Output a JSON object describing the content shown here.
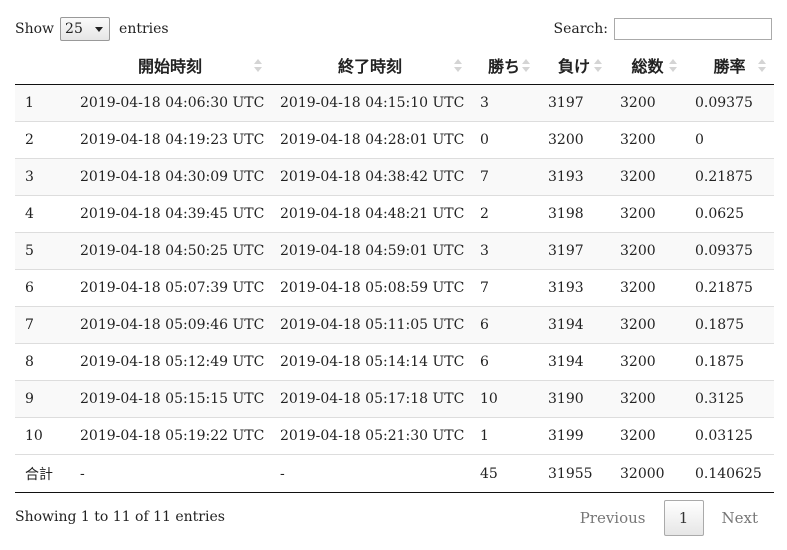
{
  "controls": {
    "show_label": "Show",
    "page_size": "25",
    "entries_label": "entries",
    "search_label": "Search:",
    "search_value": ""
  },
  "table": {
    "headers": [
      "",
      "開始時刻",
      "終了時刻",
      "勝ち",
      "負け",
      "総数",
      "勝率"
    ],
    "rows": [
      [
        "1",
        "2019-04-18 04:06:30 UTC",
        "2019-04-18 04:15:10 UTC",
        "3",
        "3197",
        "3200",
        "0.09375"
      ],
      [
        "2",
        "2019-04-18 04:19:23 UTC",
        "2019-04-18 04:28:01 UTC",
        "0",
        "3200",
        "3200",
        "0"
      ],
      [
        "3",
        "2019-04-18 04:30:09 UTC",
        "2019-04-18 04:38:42 UTC",
        "7",
        "3193",
        "3200",
        "0.21875"
      ],
      [
        "4",
        "2019-04-18 04:39:45 UTC",
        "2019-04-18 04:48:21 UTC",
        "2",
        "3198",
        "3200",
        "0.0625"
      ],
      [
        "5",
        "2019-04-18 04:50:25 UTC",
        "2019-04-18 04:59:01 UTC",
        "3",
        "3197",
        "3200",
        "0.09375"
      ],
      [
        "6",
        "2019-04-18 05:07:39 UTC",
        "2019-04-18 05:08:59 UTC",
        "7",
        "3193",
        "3200",
        "0.21875"
      ],
      [
        "7",
        "2019-04-18 05:09:46 UTC",
        "2019-04-18 05:11:05 UTC",
        "6",
        "3194",
        "3200",
        "0.1875"
      ],
      [
        "8",
        "2019-04-18 05:12:49 UTC",
        "2019-04-18 05:14:14 UTC",
        "6",
        "3194",
        "3200",
        "0.1875"
      ],
      [
        "9",
        "2019-04-18 05:15:15 UTC",
        "2019-04-18 05:17:18 UTC",
        "10",
        "3190",
        "3200",
        "0.3125"
      ],
      [
        "10",
        "2019-04-18 05:19:22 UTC",
        "2019-04-18 05:21:30 UTC",
        "1",
        "3199",
        "3200",
        "0.03125"
      ]
    ],
    "footer": [
      "合計",
      "-",
      "-",
      "45",
      "31955",
      "32000",
      "0.140625"
    ]
  },
  "info_text": "Showing 1 to 11 of 11 entries",
  "pagination": {
    "previous": "Previous",
    "current": "1",
    "next": "Next"
  }
}
